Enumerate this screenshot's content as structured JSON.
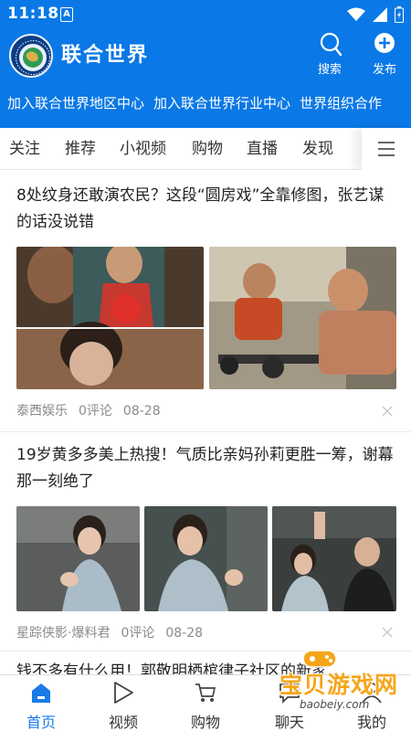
{
  "status": {
    "time": "11:18",
    "notif_letter": "A"
  },
  "app": {
    "title": "联合世界",
    "actions": [
      {
        "label": "搜索",
        "icon": "search-icon"
      },
      {
        "label": "发布",
        "icon": "plus-circle-icon"
      }
    ]
  },
  "links": [
    "加入联合世界地区中心",
    "加入联合世界行业中心",
    "世界组织合作"
  ],
  "tabs": [
    "关注",
    "推荐",
    "小视频",
    "购物",
    "直播",
    "发现"
  ],
  "feed": [
    {
      "title": "8处纹身还敢演农民？这段“圆房戏”全靠修图，张艺谋的话没说错",
      "source": "泰西娱乐",
      "comments": "0评论",
      "date": "08-28"
    },
    {
      "title": "19岁黄多多美上热搜！气质比亲妈孙莉更胜一筹，谢幕那一刻绝了",
      "source": "星踪侠影·爆料君",
      "comments": "0评论",
      "date": "08-28"
    },
    {
      "title": "钱不多有什么用！郭敬明栖棺律子社区的新家"
    }
  ],
  "bottom_nav": [
    {
      "label": "首页",
      "icon": "home-icon",
      "active": true
    },
    {
      "label": "视频",
      "icon": "play-icon"
    },
    {
      "label": "购物",
      "icon": "cart-icon"
    },
    {
      "label": "聊天",
      "icon": "chat-icon"
    },
    {
      "label": "我的",
      "icon": "profile-icon"
    }
  ],
  "watermark": {
    "text": "宝贝游戏网",
    "url": "baobeiy.com"
  },
  "colors": {
    "brand_blue": "#0a78e6",
    "active_tab": "#1a7be8",
    "meta_gray": "#8a8a8a"
  }
}
